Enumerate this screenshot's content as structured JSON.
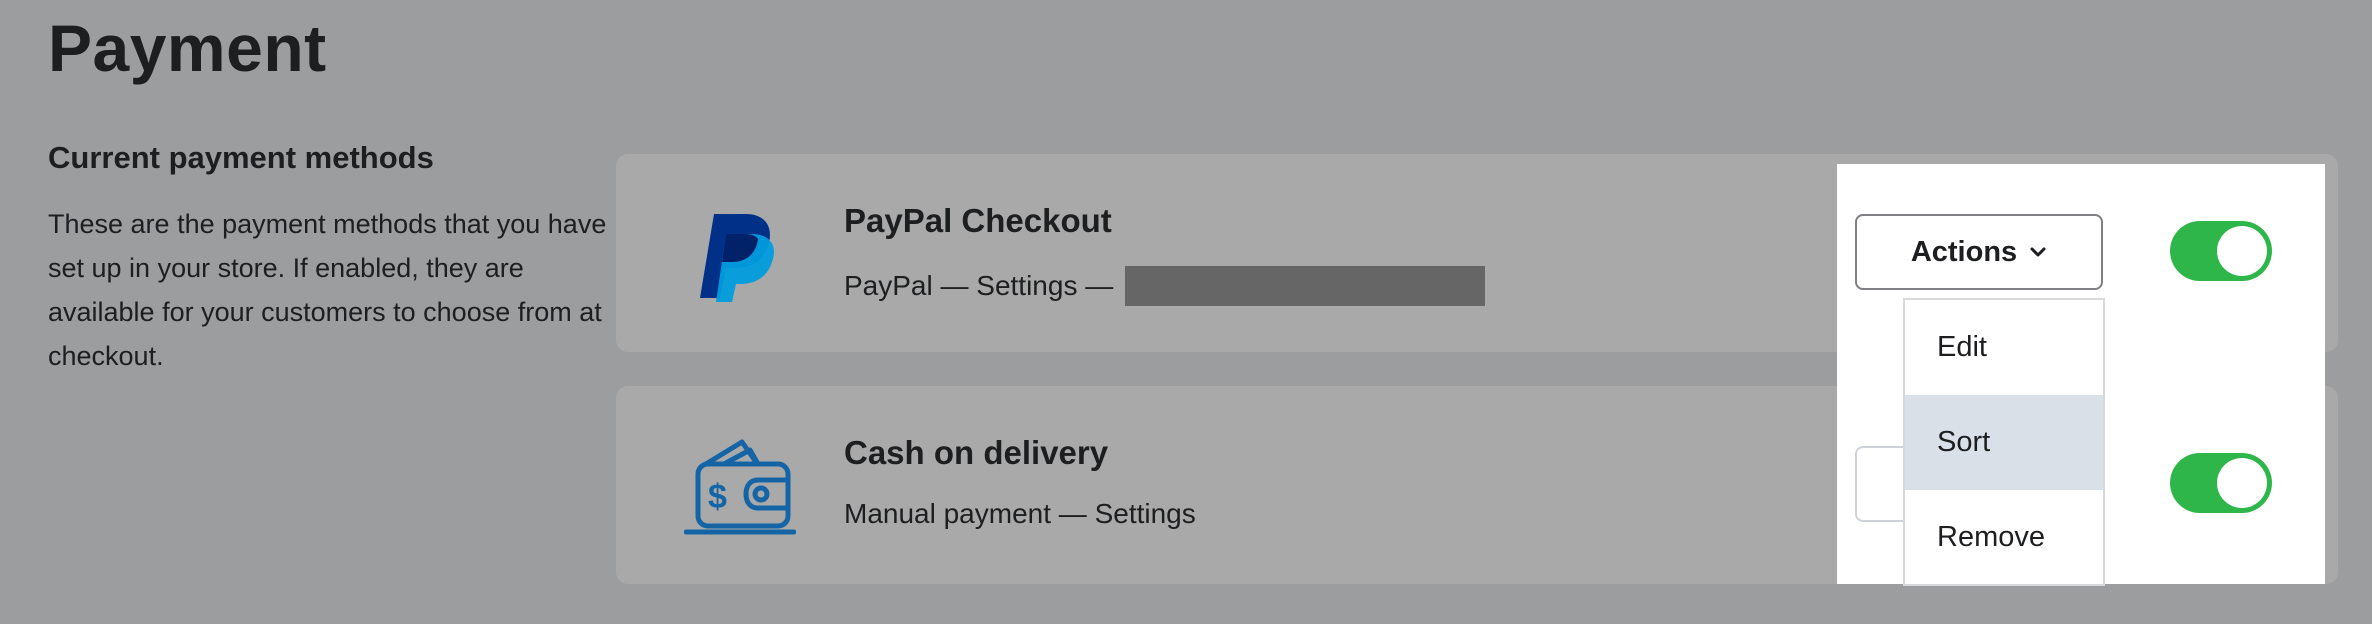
{
  "page": {
    "title": "Payment"
  },
  "section": {
    "title": "Current payment methods",
    "description": "These are the payment methods that you have set up in your store. If enabled, they are available for your customers to choose from at checkout."
  },
  "methods": [
    {
      "name": "PayPal Checkout",
      "provider": "PayPal",
      "separator": " — ",
      "settings": "Settings",
      "enabled": true,
      "logo": "paypal-logo"
    },
    {
      "name": "Cash on delivery",
      "provider": "Manual payment",
      "separator": " — ",
      "settings": "Settings",
      "enabled": true,
      "logo": "wallet-icon"
    }
  ],
  "actions": {
    "label": "Actions",
    "menu": [
      "Edit",
      "Sort",
      "Remove"
    ],
    "highlighted": "Sort"
  },
  "colors": {
    "toggle_on": "#2fb64a",
    "paypal_dark": "#003087",
    "paypal_light": "#009cde",
    "wallet_blue": "#1565a6"
  }
}
